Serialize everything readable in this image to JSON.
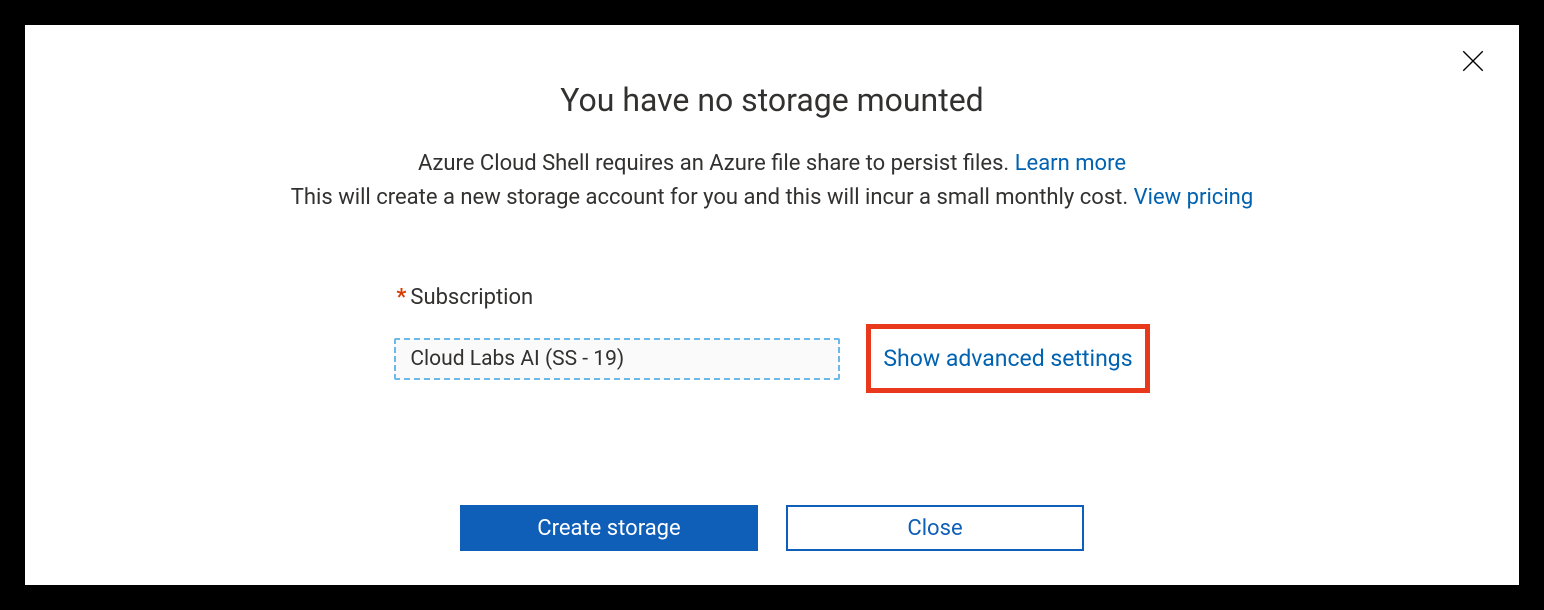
{
  "dialog": {
    "title": "You have no storage mounted",
    "desc_line1_prefix": "Azure Cloud Shell requires an Azure file share to persist files. ",
    "learn_more": "Learn more",
    "desc_line2_prefix": "This will create a new storage account for you and this will incur a small monthly cost. ",
    "view_pricing": "View pricing"
  },
  "form": {
    "subscription_label": "Subscription",
    "subscription_value": "Cloud Labs AI (SS - 19)",
    "advanced_link": "Show advanced settings"
  },
  "buttons": {
    "create": "Create storage",
    "close": "Close"
  }
}
